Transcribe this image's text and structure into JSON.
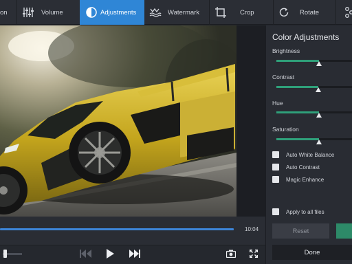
{
  "toolbar": {
    "tabs": [
      {
        "label": "on"
      },
      {
        "label": "Volume"
      },
      {
        "label": "Adjustments",
        "active": true
      },
      {
        "label": "Watermark"
      },
      {
        "label": "Crop"
      },
      {
        "label": "Rotate"
      }
    ]
  },
  "player": {
    "progress": 1.0,
    "time": "10:04",
    "volume": 0.1
  },
  "panel": {
    "title": "Color Adjustments",
    "sliders": [
      {
        "label": "Brightness",
        "value": 0.56
      },
      {
        "label": "Contrast",
        "value": 0.55
      },
      {
        "label": "Hue",
        "value": 0.56
      },
      {
        "label": "Saturation",
        "value": 0.56
      }
    ],
    "options": [
      {
        "label": "Auto White Balance",
        "checked": false
      },
      {
        "label": "Auto Contrast",
        "checked": false
      },
      {
        "label": "Magic Enhance",
        "checked": false
      }
    ],
    "apply_all": {
      "label": "Apply to all files",
      "checked": false
    },
    "reset_label": "Reset",
    "done_label": "Done"
  },
  "colors": {
    "accent": "#2f86d6",
    "slider_fill": "#2fa07a",
    "car_yellow": "#c9a91c"
  }
}
